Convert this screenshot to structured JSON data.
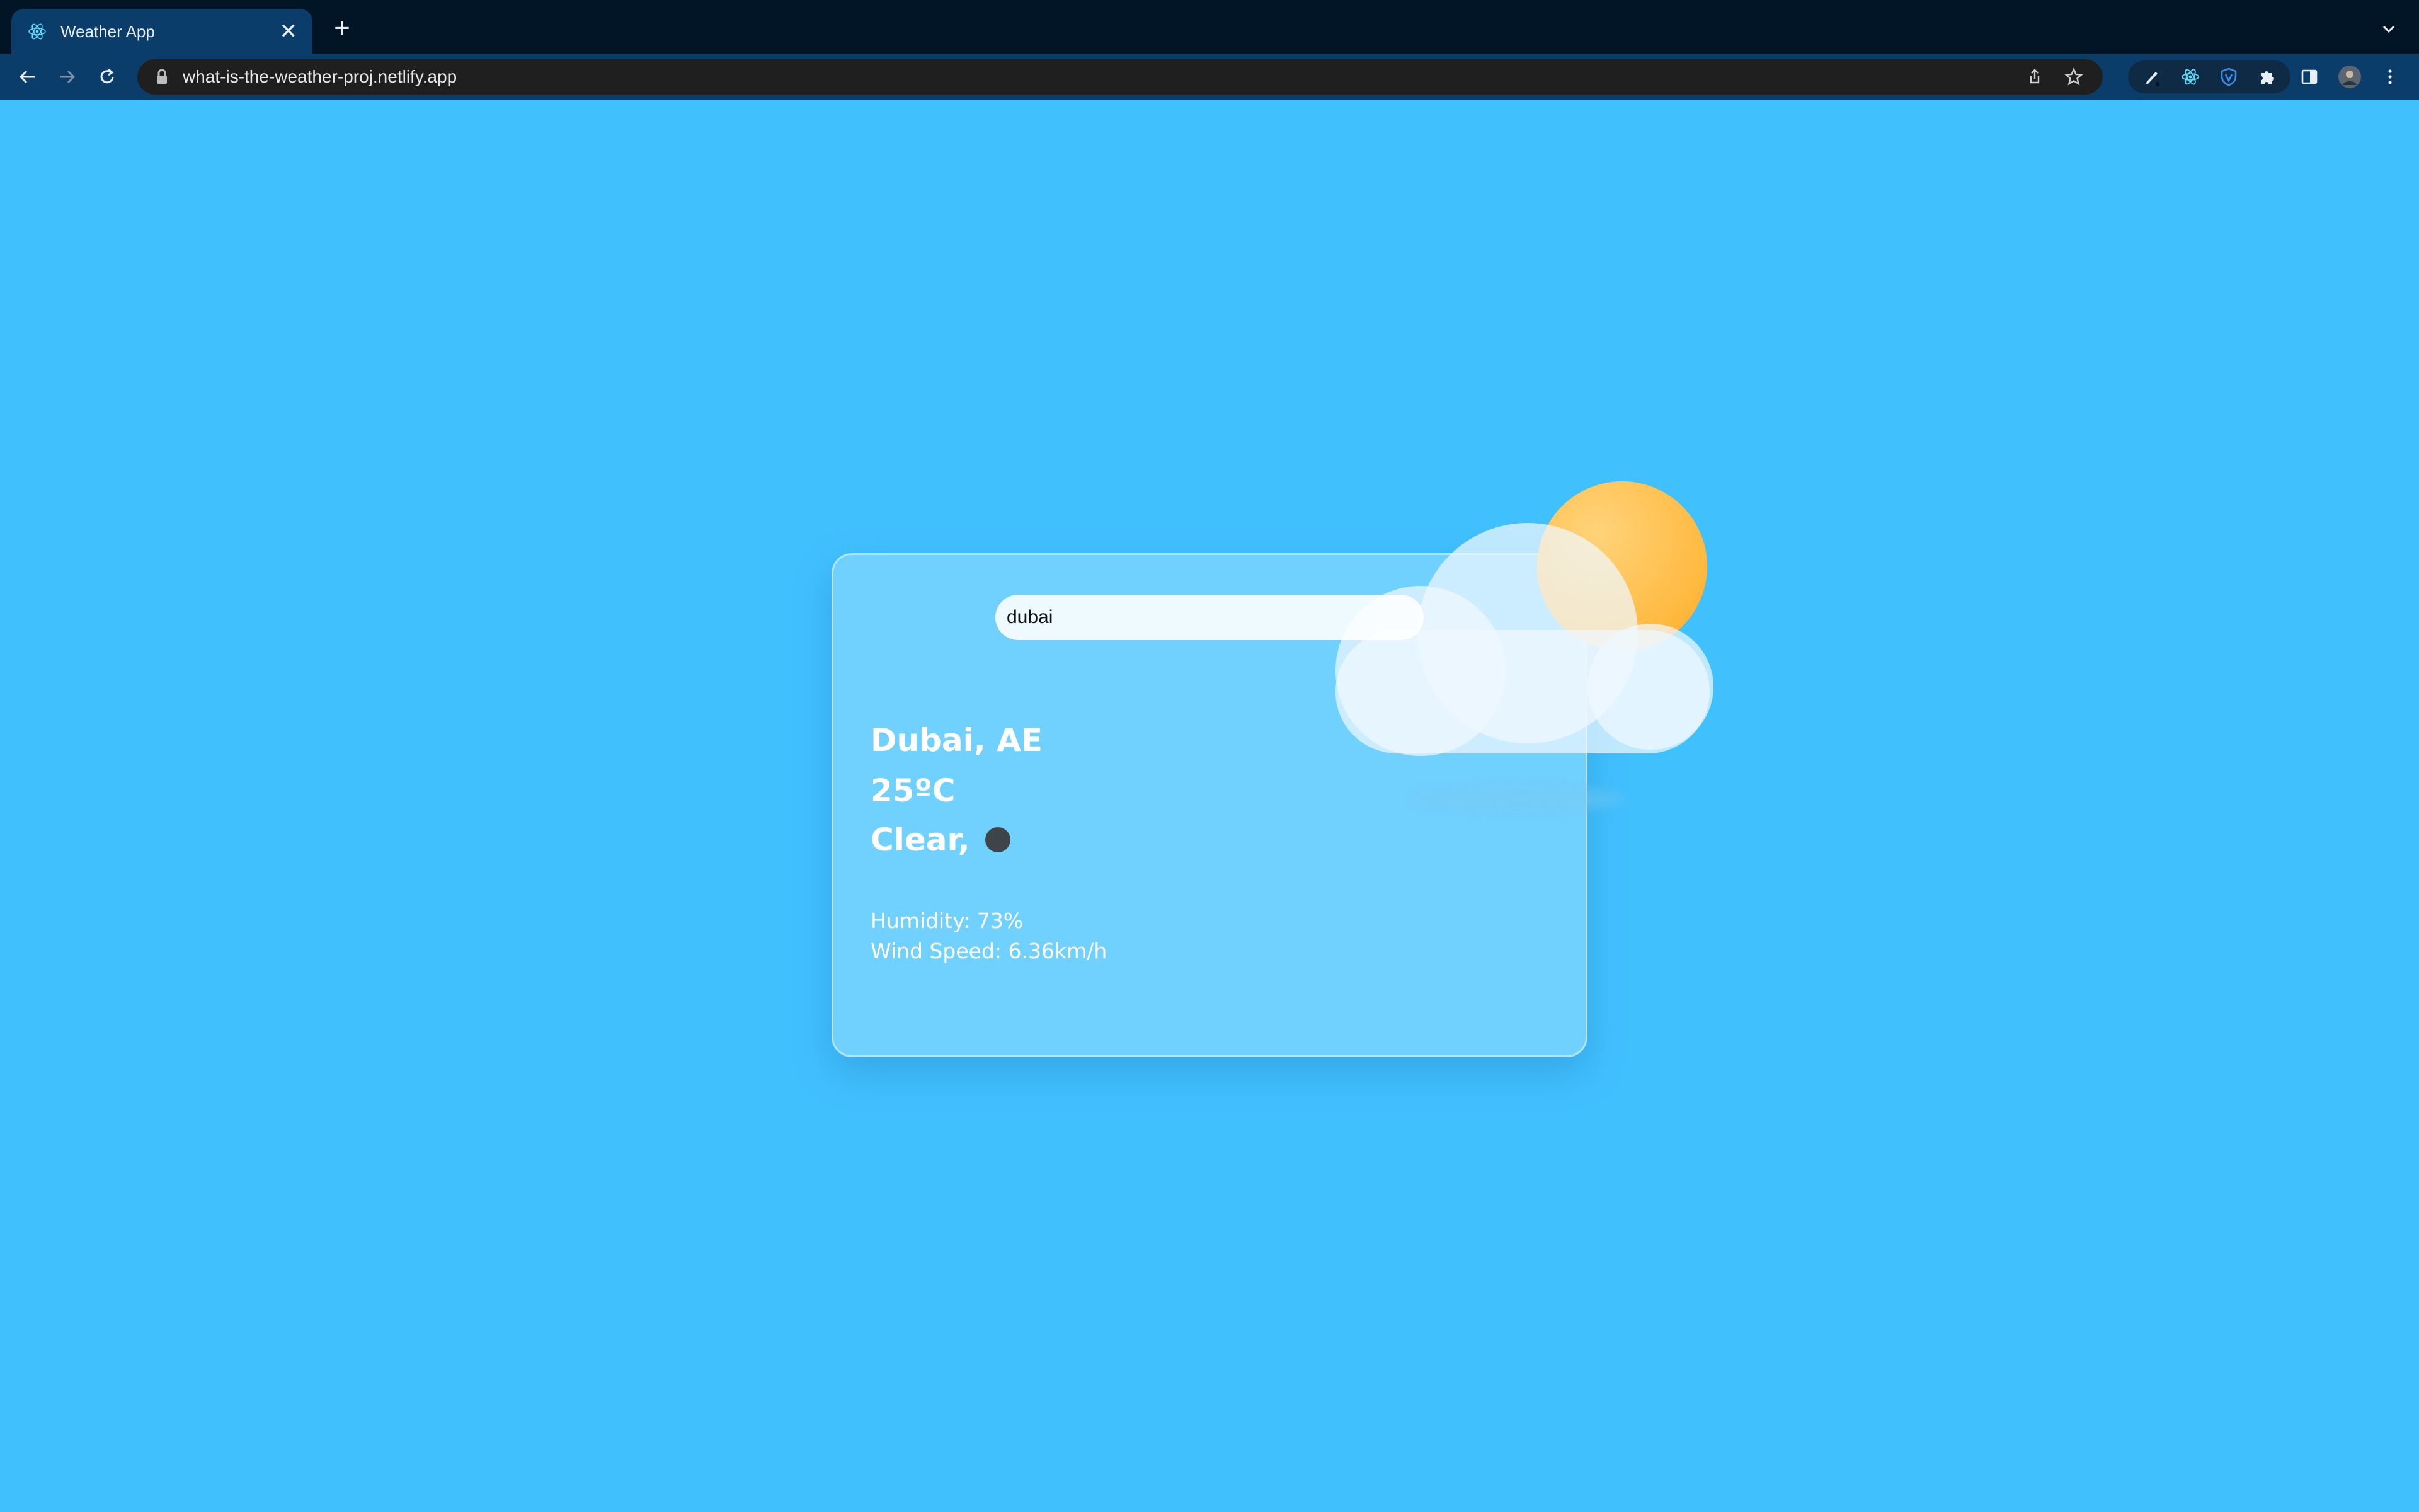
{
  "browser": {
    "tab_title": "Weather App",
    "url": "what-is-the-weather-proj.netlify.app",
    "new_tab_label": "+",
    "close_label": "✕"
  },
  "app": {
    "search": {
      "value": "dubai"
    },
    "location": "Dubai, AE",
    "temperature": "25ºC",
    "condition": "Clear,",
    "humidity": "Humidity: 73%",
    "wind_speed": "Wind Speed: 6.36km/h"
  },
  "colors": {
    "page_background": "#41c0fe",
    "sun": "#ffb93f",
    "chrome_tabbar": "#021527",
    "chrome_toolbar": "#0b3d6b"
  },
  "icons": {
    "weather_illustration": "cloud-sun-icon",
    "condition": "weather-condition-icon"
  }
}
